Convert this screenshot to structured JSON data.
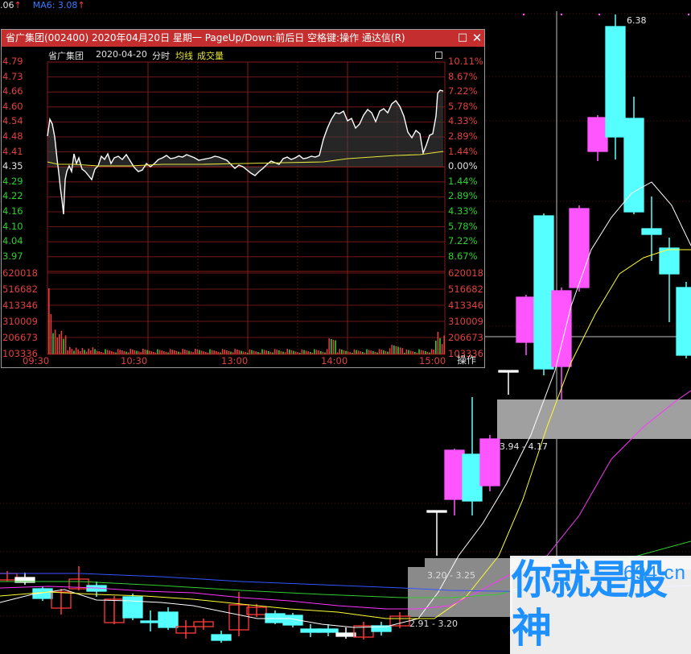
{
  "top_bar": {
    "value1": ".06",
    "value1_arrow": "↑",
    "ma6_label": "MA6: 3.08",
    "ma6_arrow": "↑"
  },
  "main_chart": {
    "high_label": "6.38",
    "zones": [
      {
        "label": "3.94 - 4.17"
      },
      {
        "label": "3.20 - 3.25"
      },
      {
        "label": "2.91 - 3.20"
      }
    ],
    "colors": {
      "up": "#ff55ff",
      "down": "#55ffff",
      "ma_white": "#ffffff",
      "ma_yellow": "#ffff33",
      "ma_magenta": "#ff33ff",
      "ma_green": "#33cc33",
      "ma_blue": "#3355ff",
      "zone": "#a0a0a0"
    }
  },
  "watermark": {
    "url": "694.cn",
    "text": "你就是股神"
  },
  "popup": {
    "title": "省广集团(002400) 2020年04月20日 星期一 PageUp/Down:前后日 空格键:操作 通达信(R)",
    "max_icon": "□",
    "close_icon": "✕",
    "stock_name": "省广集团",
    "date": "2020-04-20",
    "mode": "分时",
    "avg_line_label": "均线",
    "volume_label": "成交量",
    "price_labels": [
      "4.79",
      "4.73",
      "4.66",
      "4.60",
      "4.54",
      "4.48",
      "4.41",
      "4.35",
      "4.29",
      "4.22",
      "4.16",
      "4.10",
      "4.04",
      "3.97"
    ],
    "pct_labels": [
      "10.11%",
      "8.67%",
      "7.22%",
      "5.78%",
      "4.33%",
      "2.89%",
      "1.44%",
      "0.00%",
      "1.44%",
      "2.89%",
      "4.33%",
      "5.78%",
      "7.22%",
      "8.67%"
    ],
    "volume_labels": [
      "620018",
      "516682",
      "413346",
      "310009",
      "206673",
      "103336"
    ],
    "time_labels": [
      "09:30",
      "10:30",
      "13:00",
      "14:00",
      "15:00"
    ],
    "op_button": "操作",
    "colors": {
      "red": "#e0413d",
      "green": "#2ed02e",
      "neutral": "#e0e0e0",
      "price_line": "#ffffff",
      "avg_line": "#e6e63a",
      "grid": "#8b1a1a",
      "vol_up": "#e0413d",
      "vol_down": "#2ed02e"
    }
  }
}
